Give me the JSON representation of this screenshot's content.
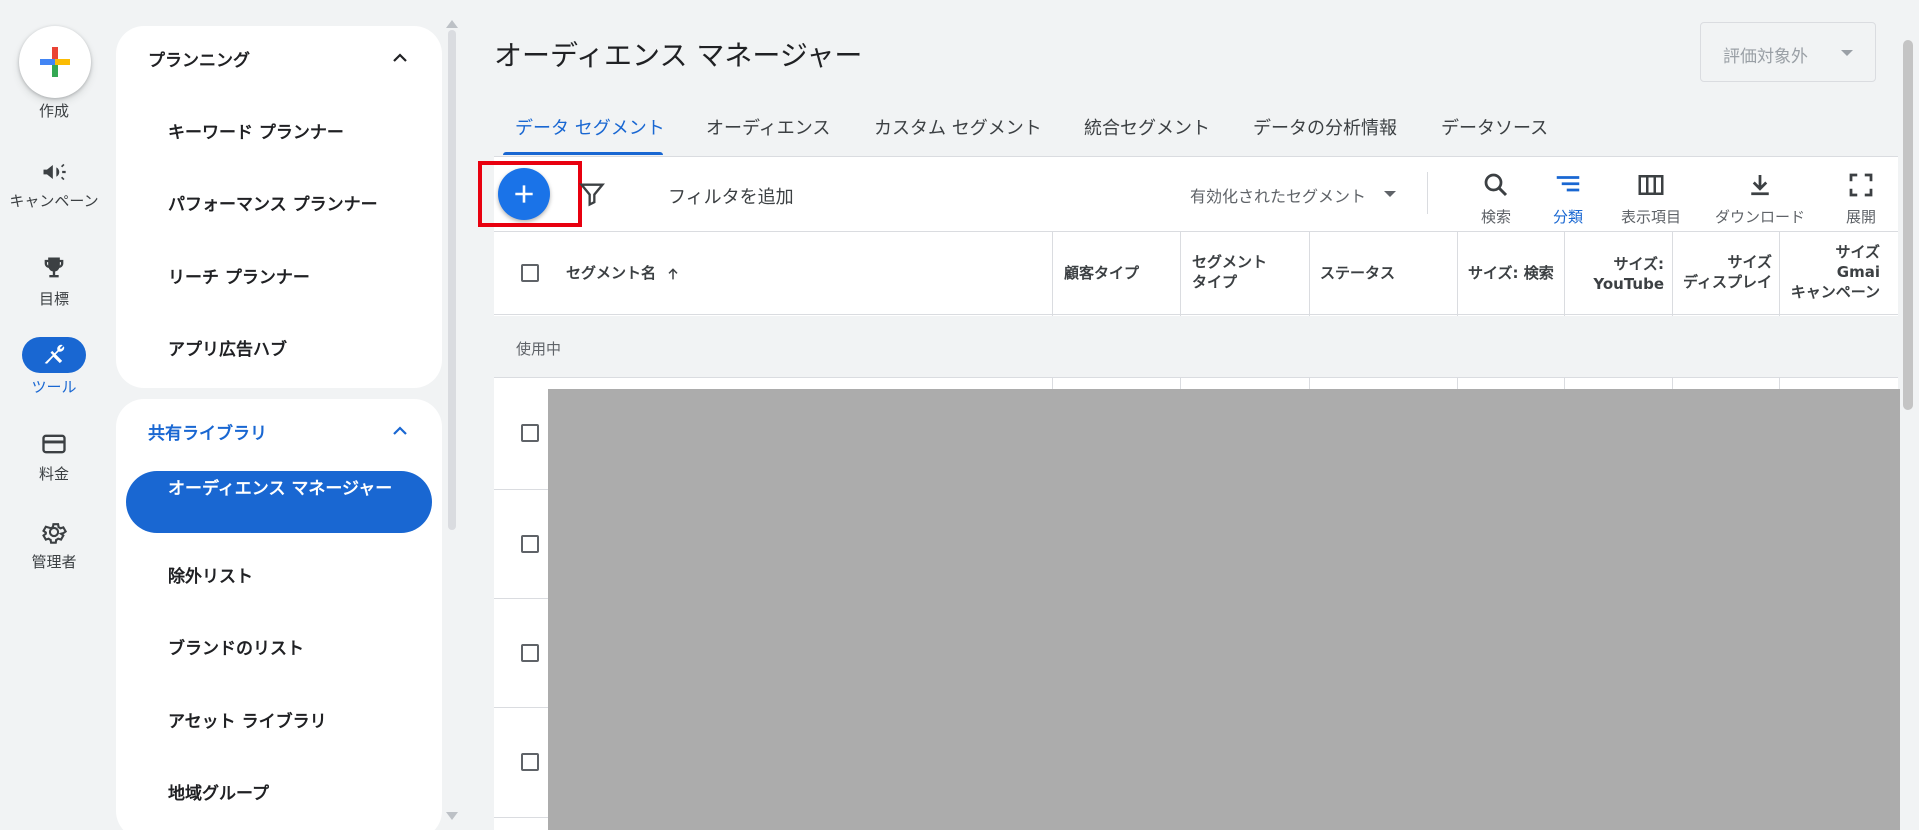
{
  "rail": {
    "create_label": "作成",
    "campaign_label": "キャンペーン",
    "goals_label": "目標",
    "tools_label": "ツール",
    "billing_label": "料金",
    "admin_label": "管理者"
  },
  "nav": {
    "planning": {
      "title": "プランニング",
      "items": [
        "キーワード プランナー",
        "パフォーマンス プランナー",
        "リーチ プランナー",
        "アプリ広告ハブ"
      ]
    },
    "shared_library": {
      "title": "共有ライブラリ",
      "active_item": "オーディエンス マネージャー",
      "items": [
        "除外リスト",
        "ブランドのリスト",
        "アセット ライブラリ",
        "地域グループ"
      ]
    }
  },
  "main": {
    "title": "オーディエンス マネージャー",
    "eval_select": "評価対象外",
    "tabs": [
      "データ セグメント",
      "オーディエンス",
      "カスタム セグメント",
      "統合セグメント",
      "データの分析情報",
      "データソース"
    ],
    "toolbar": {
      "filter_label": "フィルタを追加",
      "segment_select": "有効化されたセグメント",
      "search": "検索",
      "segment": "分類",
      "columns": "表示項目",
      "download": "ダウンロード",
      "expand": "展開"
    },
    "table": {
      "col_name": "セグメント名",
      "col_customer_type": "顧客タイプ",
      "col_segment_type_1": "セグメント",
      "col_segment_type_2": "タイプ",
      "col_status": "ステータス",
      "col_size_search": "サイズ: 検索",
      "col_size_youtube_1": "サイズ:",
      "col_size_youtube_2": "YouTube",
      "col_size_display_1": "サイズ",
      "col_size_display_2": "ディスプレイ",
      "col_size_gmail_1": "サイズ",
      "col_size_gmail_2": "Gmai",
      "col_size_gmail_3": "キャンペーン",
      "group_label": "使用中"
    }
  },
  "colors": {
    "primary": "#1967d2",
    "highlight": "#e8000f",
    "redacted": "#acacac"
  }
}
